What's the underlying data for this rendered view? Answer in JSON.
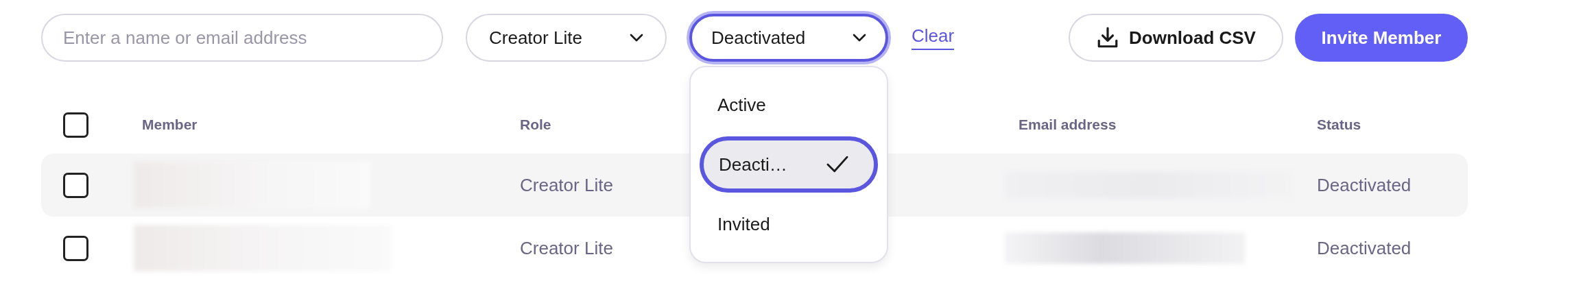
{
  "search": {
    "placeholder": "Enter a name or email address"
  },
  "filters": [
    {
      "value": "Creator Lite",
      "focused": false
    },
    {
      "value": "Deactivated",
      "focused": true
    }
  ],
  "status_menu": {
    "items": [
      {
        "label": "Active",
        "selected": false
      },
      {
        "label": "Deacti…",
        "selected": true
      },
      {
        "label": "Invited",
        "selected": false
      }
    ]
  },
  "clear_link": "Clear",
  "buttons": [
    {
      "label": "Download CSV",
      "kind": "download"
    },
    {
      "label": "Invite Member",
      "kind": "primary"
    }
  ],
  "table": {
    "columns": [
      "Member",
      "Role",
      "Email address",
      "Status"
    ],
    "header_checked": false,
    "rows": [
      {
        "checked": false,
        "highlighted": true,
        "role": "Creator Lite",
        "status": "Deactivated"
      },
      {
        "checked": false,
        "highlighted": false,
        "role": "Creator Lite",
        "status": "Deactivated"
      }
    ]
  }
}
